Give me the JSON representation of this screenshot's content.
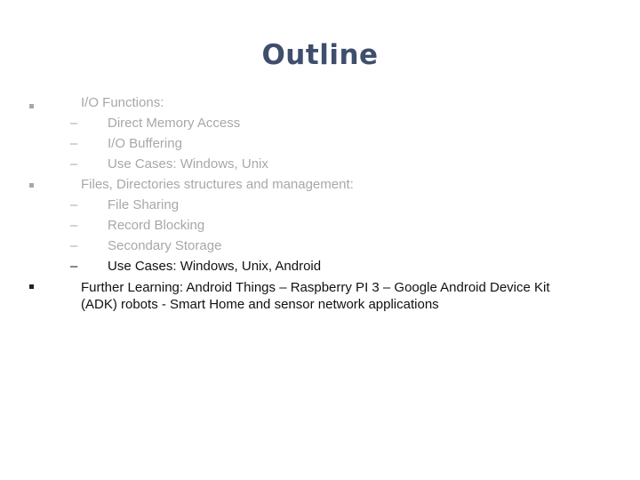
{
  "slide": {
    "title": "Outline",
    "title_color": "#3f4e6b",
    "outline": [
      {
        "label": "I/O Functions:",
        "state": "dimmed",
        "subitems": [
          {
            "label": "Direct Memory Access",
            "state": "dimmed"
          },
          {
            "label": "I/O Buffering",
            "state": "dimmed"
          },
          {
            "label": "Use Cases: Windows, Unix",
            "state": "dimmed"
          }
        ]
      },
      {
        "label": "Files, Directories structures and management:",
        "state": "dimmed",
        "subitems": [
          {
            "label": "File Sharing",
            "state": "dimmed"
          },
          {
            "label": "Record Blocking",
            "state": "dimmed"
          },
          {
            "label": "Secondary Storage",
            "state": "dimmed"
          },
          {
            "label": "Use Cases: Windows, Unix, Android",
            "state": "active"
          }
        ]
      },
      {
        "label_line1": "Further Learning: Android Things – Raspberry PI 3 – Google Android Device Kit",
        "label_line2": "(ADK) robots  - Smart Home and sensor network applications",
        "state": "active"
      }
    ],
    "dash_glyph": "–",
    "colors": {
      "dimmed_text": "#a8a8a8",
      "active_text": "#111111"
    }
  }
}
